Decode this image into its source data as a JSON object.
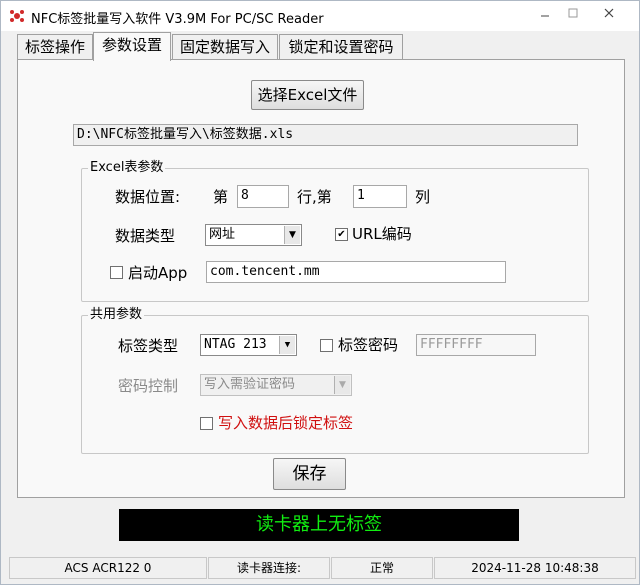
{
  "window": {
    "title": "NFC标签批量写入软件 V3.9M For PC/SC Reader",
    "minimize_icon": "minimize-icon",
    "maximize_icon": "maximize-icon",
    "close_icon": "close-icon",
    "app_icon": "nfc-app-icon"
  },
  "tabs": [
    {
      "label": "标签操作"
    },
    {
      "label": "参数设置",
      "active": true
    },
    {
      "label": "固定数据写入"
    },
    {
      "label": "锁定和设置密码"
    }
  ],
  "file": {
    "select_button": "选择Excel文件",
    "path": "D:\\NFC标签批量写入\\标签数据.xls"
  },
  "excel_params": {
    "legend": "Excel表参数",
    "data_position_label": "数据位置:",
    "row_prefix": "第",
    "row_value": "8",
    "row_suffix": "行,第",
    "col_value": "1",
    "col_suffix": "列",
    "data_type_label": "数据类型",
    "data_type_value": "网址",
    "url_encode_label": "URL编码",
    "url_encode_checked": true,
    "launch_app_label": "启动App",
    "launch_app_checked": false,
    "app_value": "com.tencent.mm"
  },
  "common_params": {
    "legend": "共用参数",
    "tag_type_label": "标签类型",
    "tag_type_value": "NTAG 213",
    "tag_password_label": "标签密码",
    "tag_password_checked": false,
    "tag_password_value": "FFFFFFFF",
    "password_control_label": "密码控制",
    "password_control_value": "写入需验证密码",
    "lock_after_write_label": "写入数据后锁定标签",
    "lock_after_write_checked": false
  },
  "save_button": "保存",
  "status_display": "读卡器上无标签",
  "statusbar": {
    "reader": "ACS ACR122 0",
    "connection_label": "读卡器连接:",
    "connection_status": "正常",
    "datetime": "2024-11-28 10:48:38"
  },
  "colors": {
    "status_display_bg": "#000000",
    "status_display_text": "#11ee11",
    "lock_label": "#d01010"
  }
}
